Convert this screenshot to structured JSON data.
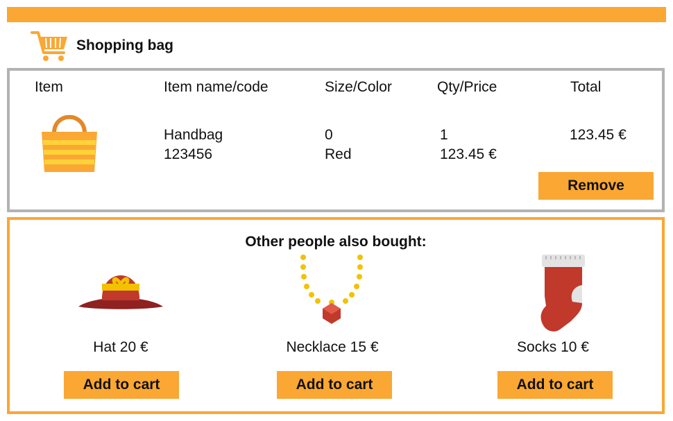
{
  "colors": {
    "accent": "#fba733",
    "border_gray": "#b3b3b3"
  },
  "header": {
    "title": "Shopping bag",
    "icon": "shopping-cart-icon"
  },
  "cart": {
    "columns": [
      "Item",
      "Item name/code",
      "Size/Color",
      "Qty/Price",
      "Total"
    ],
    "items": [
      {
        "icon": "handbag-icon",
        "name": "Handbag",
        "code": "123456",
        "size": "0",
        "color": "Red",
        "qty": "1",
        "price": "123.45 €",
        "total": "123.45 €",
        "remove_label": "Remove"
      }
    ]
  },
  "recommendations": {
    "title": "Other people also bought:",
    "products": [
      {
        "icon": "hat-icon",
        "label": "Hat 20 €",
        "button": "Add to cart"
      },
      {
        "icon": "necklace-icon",
        "label": "Necklace 15 €",
        "button": "Add to cart"
      },
      {
        "icon": "sock-icon",
        "label": "Socks 10 €",
        "button": "Add to cart"
      }
    ]
  }
}
